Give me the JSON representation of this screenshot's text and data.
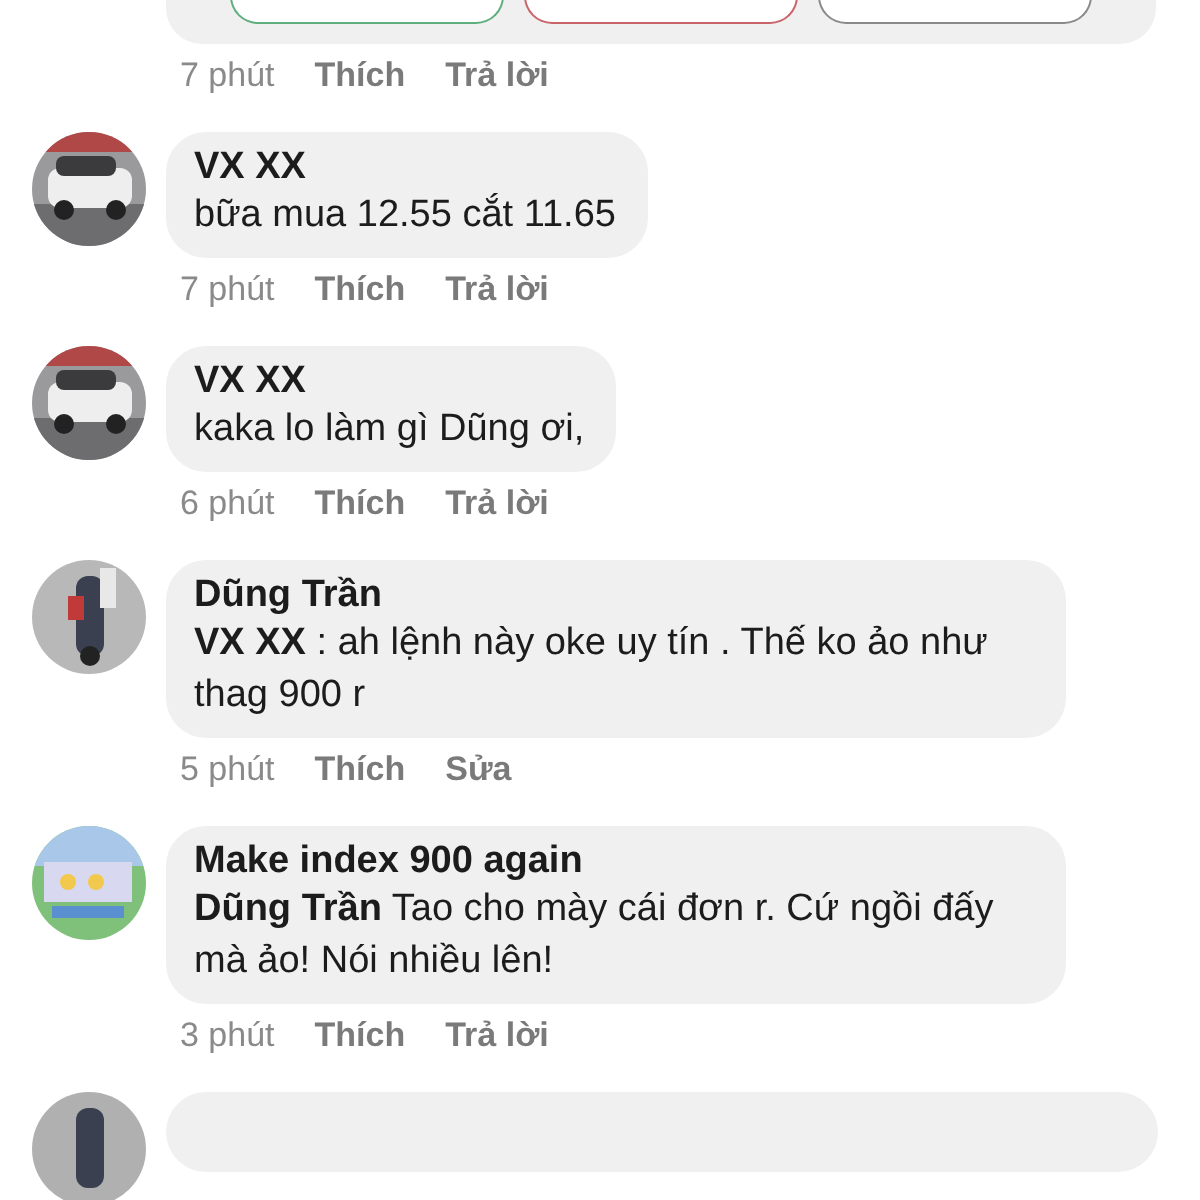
{
  "top_card": {
    "buttons": [
      {
        "color": "#5fae7e"
      },
      {
        "color": "#c9646b"
      },
      {
        "color": "#8a8a8a"
      }
    ],
    "time": "7 phút",
    "actions": [
      "Thích",
      "Trả lời"
    ]
  },
  "comments": [
    {
      "author": "VX XX",
      "text": "bữa mua 12.55 cắt 11.65",
      "time": "7 phút",
      "actions": [
        "Thích",
        "Trả lời"
      ]
    },
    {
      "author": "VX XX",
      "text": "kaka lo làm gì Dũng ơi,",
      "time": "6 phút",
      "actions": [
        "Thích",
        "Trả lời"
      ]
    },
    {
      "author": "Dũng Trần",
      "text": "**VX XX**  : ah lệnh này oke uy tín . Thế ko ảo như thag 900 r",
      "time": "5 phút",
      "actions": [
        "Thích",
        "Sửa"
      ]
    },
    {
      "author": "Make index 900 again",
      "text": "**Dũng Trần**   Tao cho mày cái đơn r. Cứ ngồi đấy mà ảo!  Nói nhiều lên!",
      "time": "3 phút",
      "actions": [
        "Thích",
        "Trả lời"
      ]
    }
  ]
}
